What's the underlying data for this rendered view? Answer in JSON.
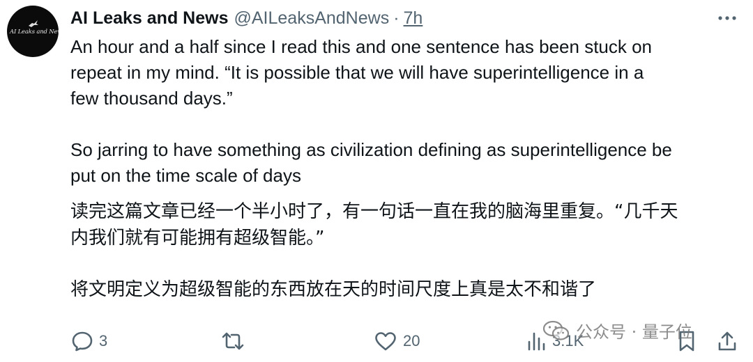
{
  "tweet": {
    "author_name": "AI Leaks and News",
    "handle": "@AILeaksAndNews",
    "separator": "·",
    "time": "7h",
    "avatar_text": "AI Leaks and News",
    "body_en": [
      "An hour and a half since I read this and one sentence has been stuck on",
      "repeat in my mind. “It is possible that we will have superintelligence in a",
      "few thousand days.”",
      "So jarring to have something as civilization defining as superintelligence be",
      "put on the time scale of days"
    ],
    "body_zh": [
      "读完这篇文章已经一个半小时了，有一句话一直在我的脑海里重复。“几千天",
      "内我们就有可能拥有超级智能。”",
      "将文明定义为超级智能的东西放在天的时间尺度上真是太不和谐了"
    ]
  },
  "actions": {
    "reply_count": "3",
    "retweet_count": "",
    "like_count": "20",
    "views_count": "3.1K"
  },
  "icons": {
    "reply": "reply-icon",
    "retweet": "retweet-icon",
    "like": "heart-icon",
    "views": "views-icon",
    "bookmark": "bookmark-icon",
    "share": "share-icon",
    "more": "more-icon"
  },
  "watermark": {
    "text": "公众号 · 量子位"
  },
  "colors": {
    "text_primary": "#0f1419",
    "text_secondary": "#536471",
    "avatar_bg": "#0b0b0b"
  }
}
